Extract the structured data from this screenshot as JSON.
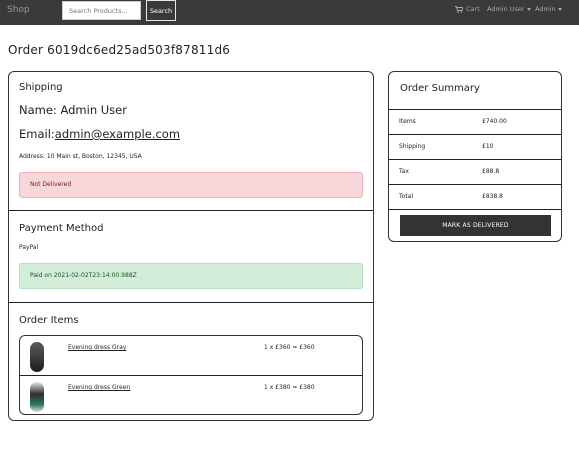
{
  "navbar": {
    "brand": "Shop",
    "search_placeholder": "Search Products...",
    "search_button": "Search",
    "cart_label": "Cart",
    "user_menu": "Admin User",
    "admin_menu": "Admin"
  },
  "page": {
    "title": "Order 6019dc6ed25ad503f87811d6"
  },
  "shipping": {
    "heading": "Shipping",
    "name_line": "Name: Admin User",
    "email_prefix": "Email:",
    "email": "admin@example.com",
    "address": "Address: 10 Main st, Boston, 12345, USA",
    "delivery_status": "Not Delivered"
  },
  "payment": {
    "heading": "Payment Method",
    "method": "PayPal",
    "status": "Paid on 2021-02-02T23:14:00.988Z"
  },
  "order_items": {
    "heading": "Order Items",
    "items": [
      {
        "name": "Evening dress Gray",
        "price_line": "1 x £360 = £360"
      },
      {
        "name": "Evening dress Green",
        "price_line": "1 x £380 = £380"
      }
    ]
  },
  "summary": {
    "heading": "Order Summary",
    "rows": [
      {
        "label": "Items",
        "value": "£740.00"
      },
      {
        "label": "Shipping",
        "value": "£10"
      },
      {
        "label": "Tax",
        "value": "£88.8"
      },
      {
        "label": "Total",
        "value": "£838.8"
      }
    ],
    "deliver_button": "Mark As Delivered"
  }
}
